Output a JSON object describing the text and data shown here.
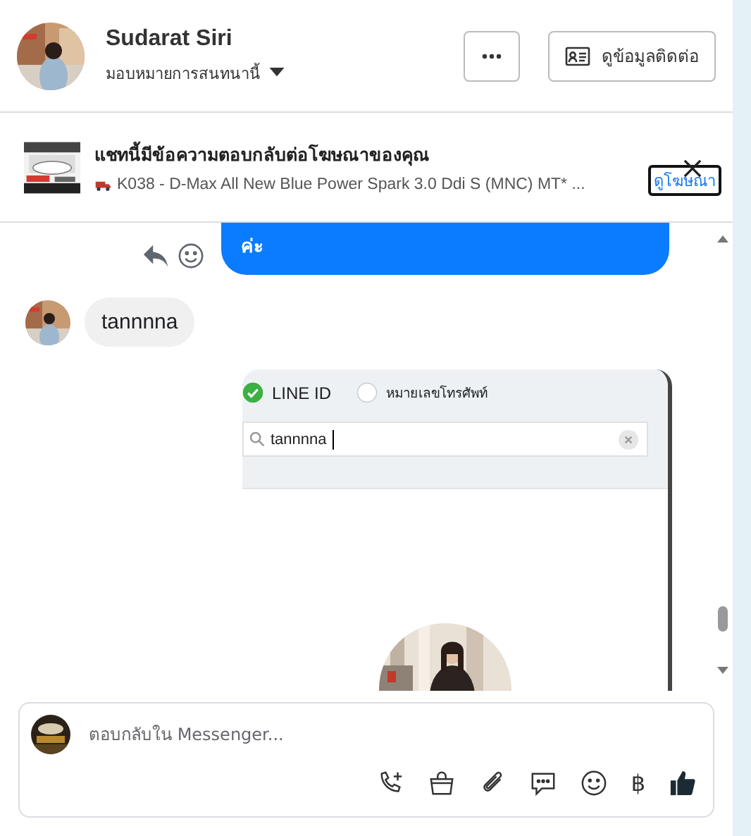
{
  "header": {
    "name": "Sudarat Siri",
    "assign_label": "มอบหมายการสนทนานี้",
    "contact_button": "ดูข้อมูลติดต่อ"
  },
  "ad_banner": {
    "title": "แชทนี้มีข้อความตอบกลับต่อโฆษณาของคุณ",
    "subtitle": "K038 - D-Max All New Blue Power Spark 3.0 Ddi S (MNC) MT* ...",
    "link": "ดูโฆษณา"
  },
  "messages": [
    {
      "kind": "outgoing_text",
      "text": "ค่ะ"
    },
    {
      "kind": "incoming_text",
      "text": "tannnna"
    },
    {
      "kind": "outgoing_screenshot",
      "options": [
        {
          "label": "LINE ID",
          "selected": true
        },
        {
          "label": "หมายเลขโทรศัพท์",
          "selected": false
        }
      ],
      "search_value": "tannnna"
    }
  ],
  "composer": {
    "placeholder": "ตอบกลับใน Messenger...",
    "currency_symbol": "฿"
  }
}
